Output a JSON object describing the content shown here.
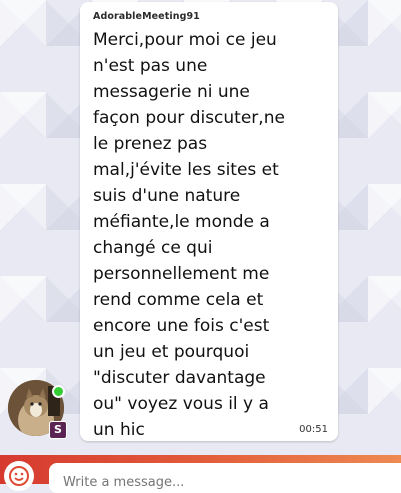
{
  "message": {
    "sender": "AdorableMeeting91",
    "lines": [
      "Merci,pour moi ce jeu",
      "n'est pas une",
      "messagerie ni une",
      "façon pour discuter,ne",
      "le prenez pas",
      "mal,j'évite les sites et",
      "suis d'une nature",
      "méfiante,le monde a",
      "changé ce qui",
      "personnellement me",
      "rend comme cela  et",
      "encore une fois c'est",
      "un jeu et pourquoi",
      "\"discuter davantage",
      "ou\" voyez vous il y a",
      "un hic"
    ],
    "time": "00:51"
  },
  "avatar": {
    "online": true,
    "badge": "S",
    "badge_color": "#5b2353",
    "online_color": "#33cc33"
  },
  "composer": {
    "placeholder": "Write a message...",
    "emoji_icon": "smiley-icon",
    "bar_colors": [
      "#d63a2f",
      "#ee8a52"
    ]
  }
}
